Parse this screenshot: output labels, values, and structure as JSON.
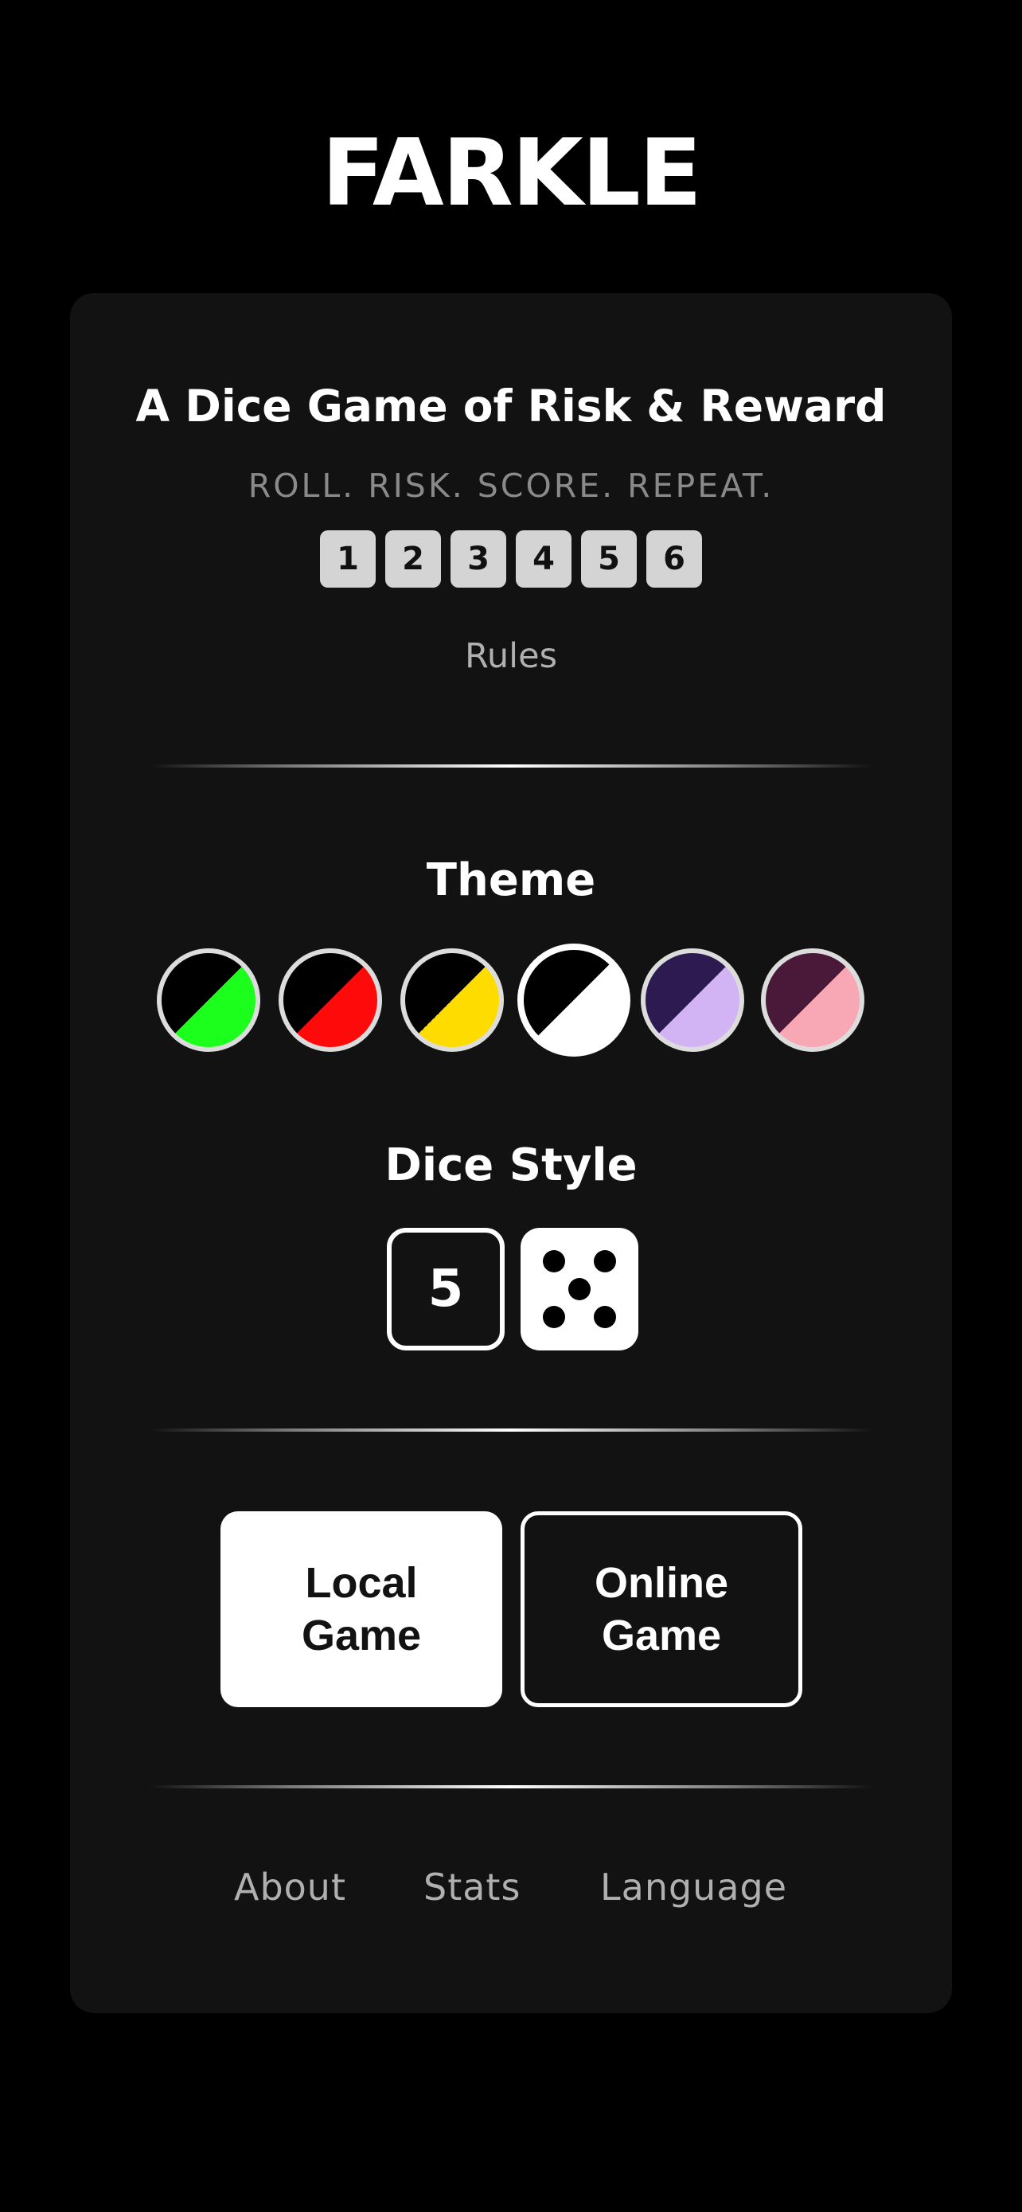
{
  "app": {
    "title": "FARKLE"
  },
  "intro": {
    "tagline": "A Dice Game of Risk & Reward",
    "subtitle": "ROLL. RISK. SCORE. REPEAT.",
    "dice_numbers": [
      "1",
      "2",
      "3",
      "4",
      "5",
      "6"
    ],
    "rules_label": "Rules"
  },
  "theme": {
    "title": "Theme",
    "selected_index": 3,
    "options": [
      {
        "name": "black-green",
        "color_a": "#000000",
        "color_b": "#1cff1c"
      },
      {
        "name": "black-red",
        "color_a": "#000000",
        "color_b": "#ff0a0a"
      },
      {
        "name": "black-yellow",
        "color_a": "#000000",
        "color_b": "#ffdc00"
      },
      {
        "name": "black-white",
        "color_a": "#000000",
        "color_b": "#ffffff"
      },
      {
        "name": "purple-lavender",
        "color_a": "#2c1a50",
        "color_b": "#d2b4f5"
      },
      {
        "name": "plum-pink",
        "color_a": "#4a1838",
        "color_b": "#f8a8b4"
      }
    ]
  },
  "dice_style": {
    "title": "Dice Style",
    "numeric_label": "5",
    "selected": "pips"
  },
  "mode": {
    "local_label": "Local Game",
    "online_label": "Online Game"
  },
  "footer": {
    "about_label": "About",
    "stats_label": "Stats",
    "language_label": "Language"
  },
  "colors": {
    "background": "#000000",
    "card": "#121212",
    "text": "#ffffff",
    "muted_text": "#8a8a8a",
    "die_face": "#d4d4d4"
  }
}
